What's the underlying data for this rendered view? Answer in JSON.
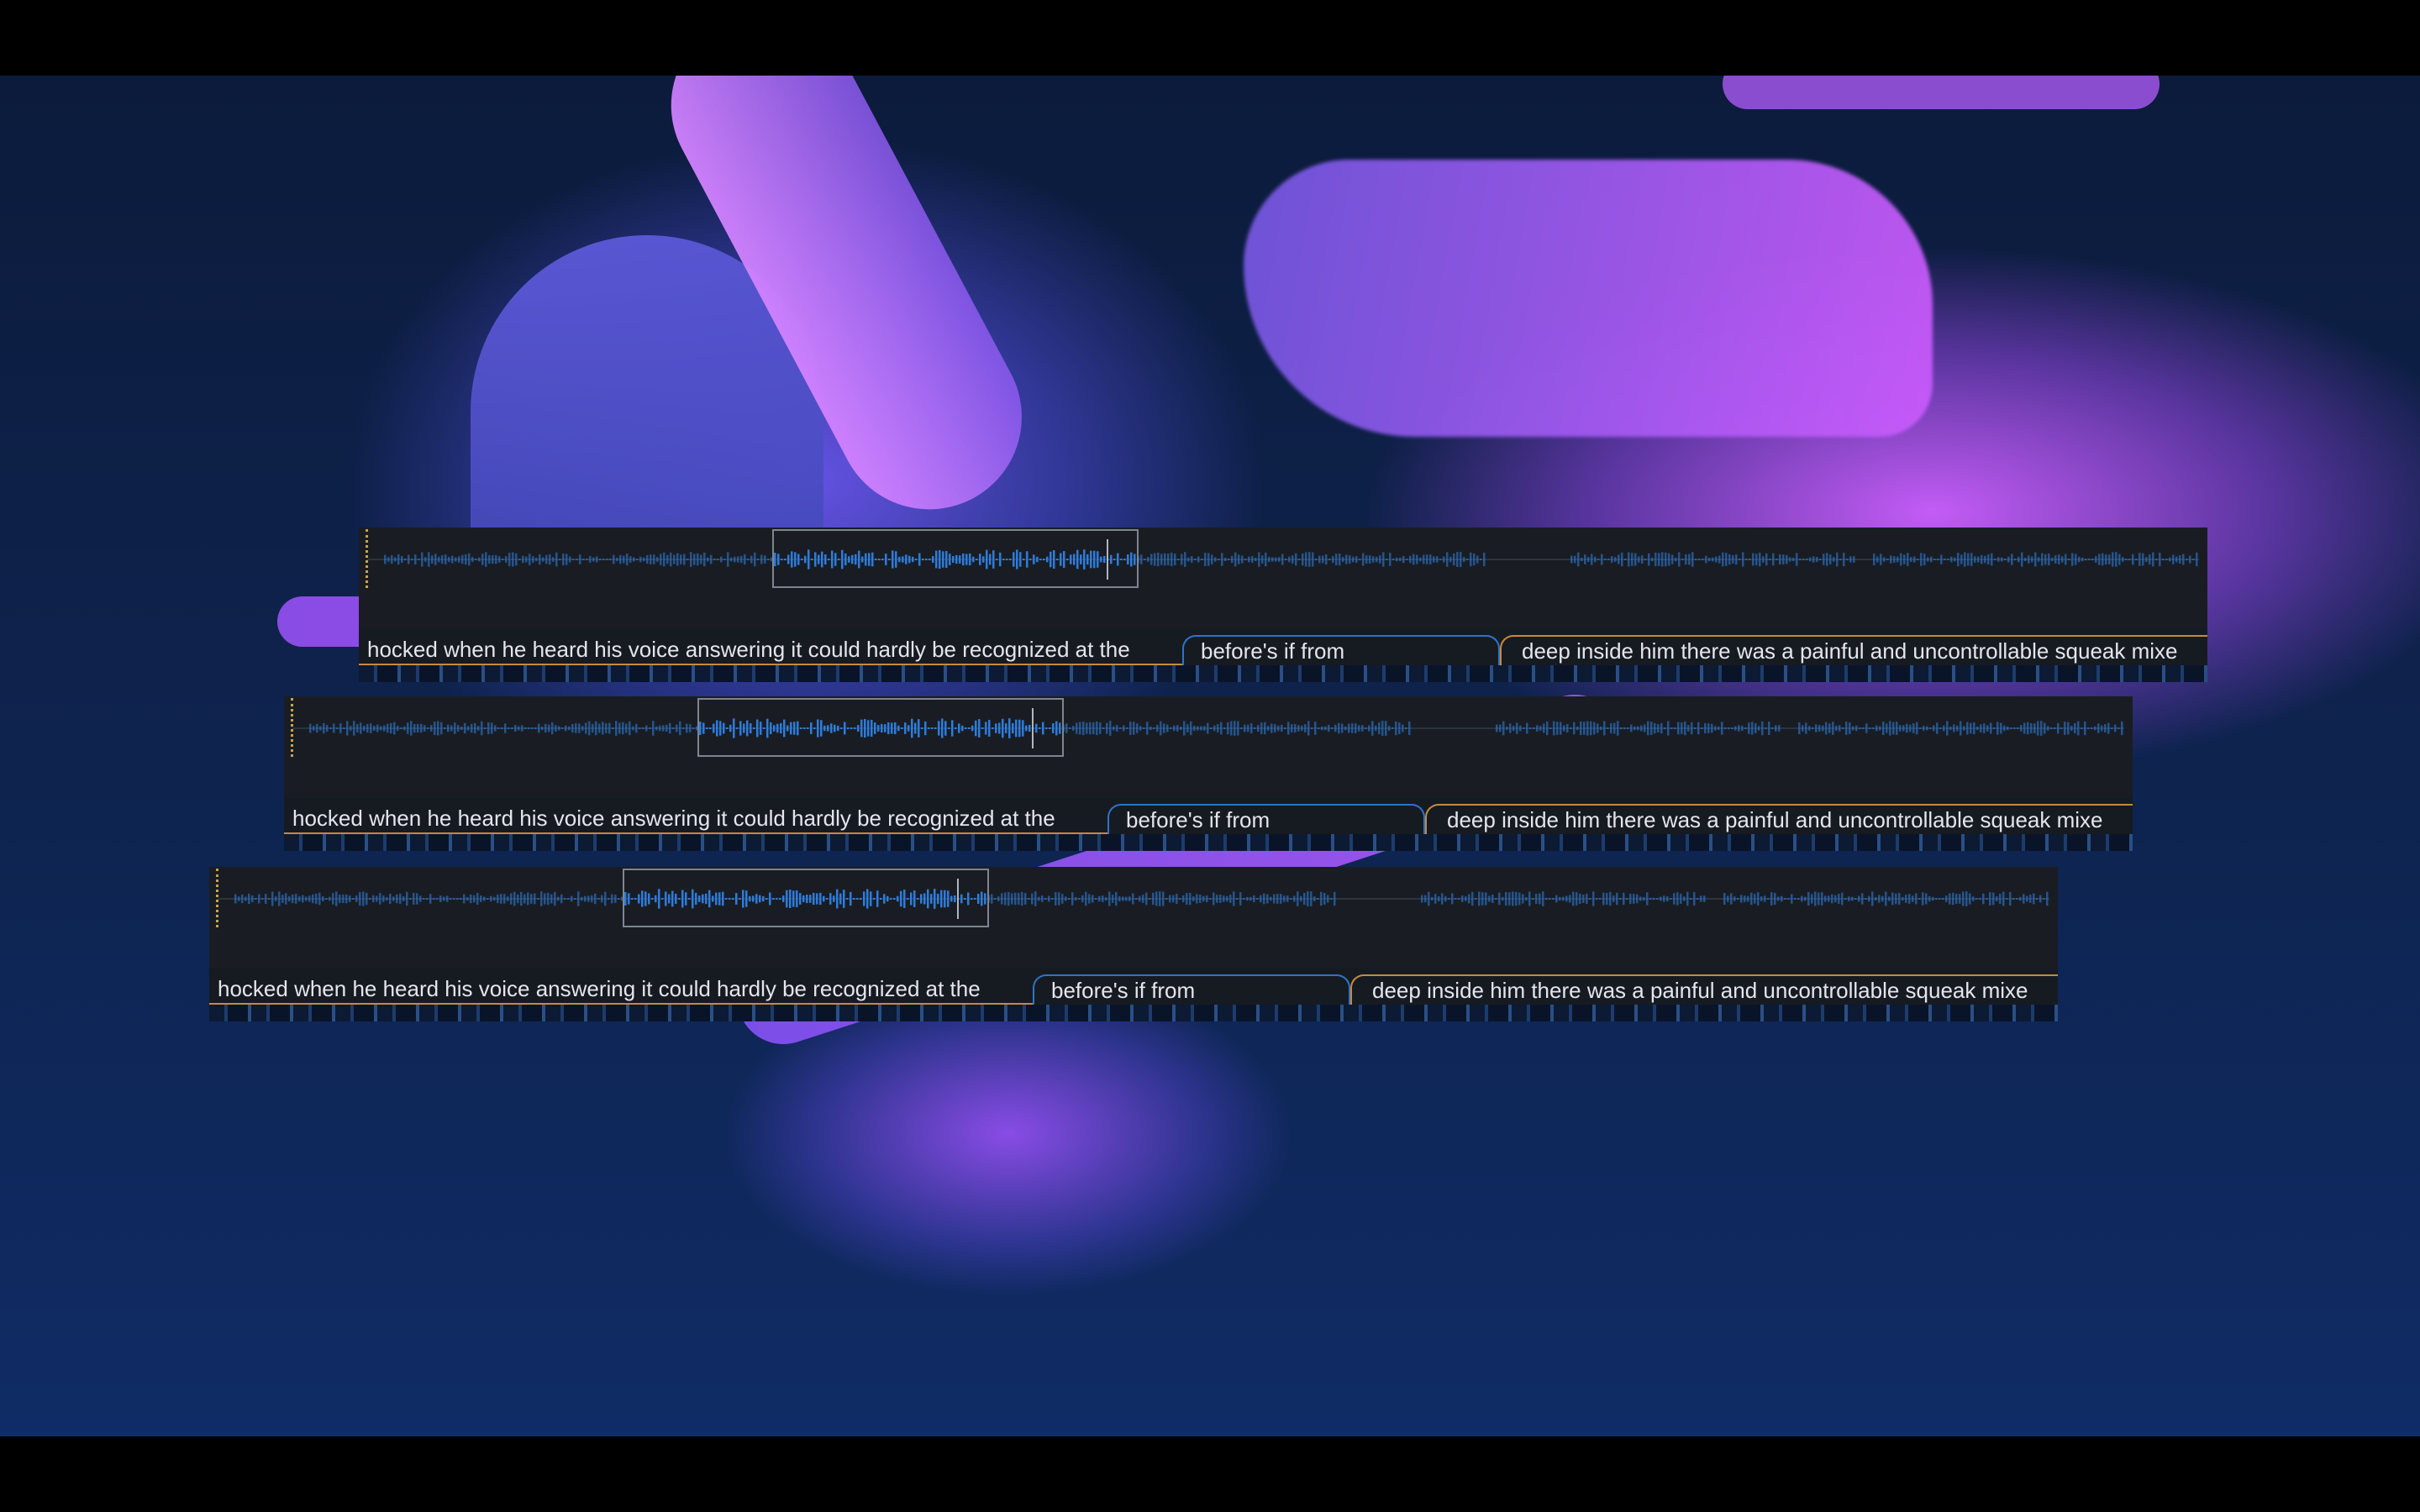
{
  "screen": {
    "background": "desktop-wallpaper-abstract-ribbon",
    "accent_colors": {
      "waveform": "#2e82e6",
      "selection": "#7d8590",
      "transcript_text": "#e3e6ea",
      "segment_border": "#c68a3e",
      "active_segment": "#2e73c8"
    }
  },
  "editors": [
    {
      "transcript": {
        "segment_1": "hocked when he heard his voice answering it could hardly be recognized at the",
        "segment_2": "before's if from",
        "segment_3": "deep inside him there was a painful and uncontrollable squeak mixe"
      }
    },
    {
      "transcript": {
        "segment_1": "hocked when he heard his voice answering it could hardly be recognized at the",
        "segment_2": "before's if from",
        "segment_3": "deep inside him there was a painful and uncontrollable squeak mixe"
      }
    },
    {
      "transcript": {
        "segment_1": "hocked when he heard his voice answering it could hardly be recognized at the",
        "segment_2": "before's if from",
        "segment_3": "deep inside him there was a painful and uncontrollable squeak mixe"
      }
    }
  ]
}
